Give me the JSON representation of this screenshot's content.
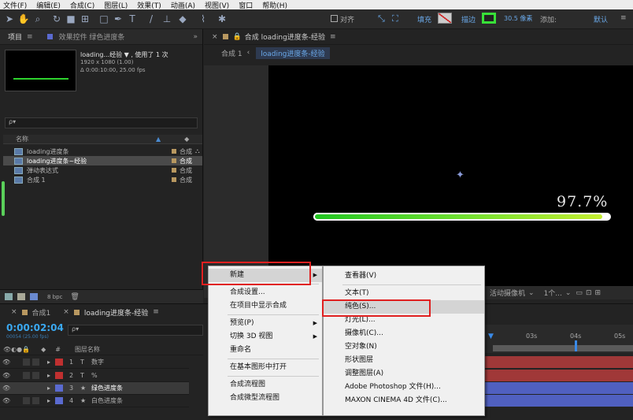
{
  "menubar": [
    "文件(F)",
    "编辑(E)",
    "合成(C)",
    "图层(L)",
    "效果(T)",
    "动画(A)",
    "视图(V)",
    "窗口",
    "帮助(H)"
  ],
  "toolbar": {
    "snap_label": "对齐",
    "fill_label": "填充",
    "stroke_label": "描边",
    "stroke_value": "30.5 像素",
    "add_label": "添加:",
    "workspace": "默认"
  },
  "project_panel": {
    "tab_project": "项目",
    "tab_effects": "效果控件 绿色进度条",
    "comp_name": "loading...经验 ▼ , 使用了 1 次",
    "comp_size": "1920 x 1080 (1.00)",
    "comp_duration": "Δ 0:00:10:00, 25.00 fps",
    "search_placeholder": "ρ▾",
    "col_name": "名称",
    "items": [
      {
        "name": "loading进度条",
        "type": "合成"
      },
      {
        "name": "loading进度条~经验",
        "type": "合成"
      },
      {
        "name": "弹动表达式",
        "type": "合成"
      },
      {
        "name": "合成 1",
        "type": "合成"
      }
    ],
    "bit_depth": "8 bpc"
  },
  "comp_panel": {
    "tab_title": "合成 loading进度条-经验",
    "breadcrumb_1": "合成 1",
    "breadcrumb_2": "loading进度条-经验",
    "percent": "97.7%",
    "progress": 0.977,
    "camera": "活动摄像机",
    "views": "1个..."
  },
  "timeline": {
    "tab_1": "合成1",
    "tab_2": "loading进度条-经验",
    "timecode": "0:00:02:04",
    "frames": "00054 (25.00 fps)",
    "col_layer": "图层名称",
    "col_num": "#",
    "ticks": [
      "03s",
      "04s",
      "05s"
    ],
    "layers": [
      {
        "num": "1",
        "type": "T",
        "name": "数字",
        "color": "#c03030"
      },
      {
        "num": "2",
        "type": "T",
        "name": "%",
        "color": "#c03030"
      },
      {
        "num": "3",
        "type": "★",
        "name": "绿色进度条",
        "color": "#5a6ad0"
      },
      {
        "num": "4",
        "type": "★",
        "name": "白色进度条",
        "color": "#5a6ad0"
      }
    ]
  },
  "context_menu": {
    "items": [
      "新建",
      "合成设置...",
      "在项目中显示合成",
      "预览(P)",
      "切换 3D 视图",
      "重命名",
      "在基本图形中打开",
      "合成流程图",
      "合成微型流程图"
    ]
  },
  "submenu": {
    "items": [
      "查看器(V)",
      "文本(T)",
      "纯色(S)...",
      "灯光(L)...",
      "摄像机(C)...",
      "空对象(N)",
      "形状图层",
      "调整图层(A)",
      "Adobe Photoshop 文件(H)...",
      "MAXON CINEMA 4D 文件(C)..."
    ]
  }
}
